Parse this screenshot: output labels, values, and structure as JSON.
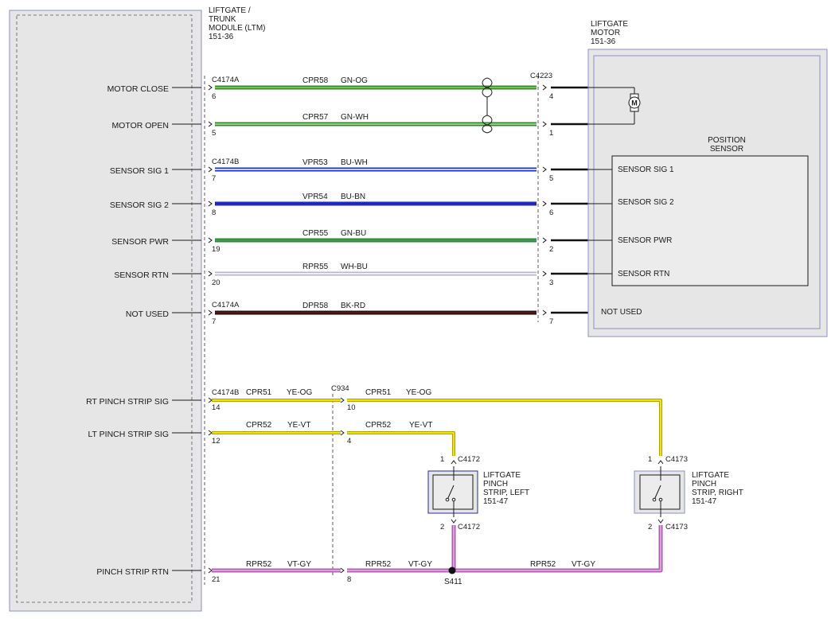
{
  "module": {
    "title_lines": [
      "LIFTGATE /",
      "TRUNK",
      "MODULE (LTM)",
      "151-36"
    ],
    "signals": [
      {
        "id": "motor-close",
        "label": "MOTOR CLOSE"
      },
      {
        "id": "motor-open",
        "label": "MOTOR OPEN"
      },
      {
        "id": "sensor-sig-1",
        "label": "SENSOR SIG 1"
      },
      {
        "id": "sensor-sig-2",
        "label": "SENSOR SIG 2"
      },
      {
        "id": "sensor-pwr",
        "label": "SENSOR PWR"
      },
      {
        "id": "sensor-rtn",
        "label": "SENSOR RTN"
      },
      {
        "id": "not-used",
        "label": "NOT USED"
      },
      {
        "id": "rt-pinch-strip-sig",
        "label": "RT PINCH STRIP SIG"
      },
      {
        "id": "lt-pinch-strip-sig",
        "label": "LT PINCH STRIP SIG"
      },
      {
        "id": "pinch-strip-rtn",
        "label": "PINCH STRIP RTN"
      }
    ]
  },
  "motor_module": {
    "title_lines": [
      "LIFTGATE",
      "MOTOR",
      "151-36"
    ],
    "motor_symbol": "M",
    "sensor_title_lines": [
      "POSITION",
      "SENSOR"
    ],
    "sensor_pins": [
      "SENSOR SIG 1",
      "SENSOR SIG 2",
      "SENSOR PWR",
      "SENSOR RTN"
    ],
    "not_used_label": "NOT USED"
  },
  "motor_wires": [
    {
      "id": "cpr58",
      "circuit": "CPR58",
      "color_code": "GN-OG",
      "left_connector": "C4174A",
      "left_pin": "6",
      "right_connector": "C4223",
      "right_pin": "4",
      "stroke": "#2e8b2e",
      "stripe": "#8fd14f"
    },
    {
      "id": "cpr57",
      "circuit": "CPR57",
      "color_code": "GN-WH",
      "left_connector": "",
      "left_pin": "5",
      "right_connector": "",
      "right_pin": "1",
      "stroke": "#2e8b2e",
      "stripe": "#b6e0a0"
    },
    {
      "id": "vpr53",
      "circuit": "VPR53",
      "color_code": "BU-WH",
      "left_connector": "C4174B",
      "left_pin": "7",
      "right_connector": "",
      "right_pin": "5",
      "stroke": "#1a2fd0",
      "stripe": "#ffffff"
    },
    {
      "id": "vpr54",
      "circuit": "VPR54",
      "color_code": "BU-BN",
      "left_connector": "",
      "left_pin": "8",
      "right_connector": "",
      "right_pin": "6",
      "stroke": "#1a2fd0",
      "stripe": "#2a1fa0"
    },
    {
      "id": "cpr55",
      "circuit": "CPR55",
      "color_code": "GN-BU",
      "left_connector": "",
      "left_pin": "19",
      "right_connector": "",
      "right_pin": "2",
      "stroke": "#2e8b2e",
      "stripe": "#4a9a6a"
    },
    {
      "id": "rpr55",
      "circuit": "RPR55",
      "color_code": "WH-BU",
      "left_connector": "",
      "left_pin": "20",
      "right_connector": "",
      "right_pin": "3",
      "stroke": "#b8b8c8",
      "stripe": "#ffffff"
    },
    {
      "id": "dpr58",
      "circuit": "DPR58",
      "color_code": "BK-RD",
      "left_connector": "C4174A",
      "left_pin": "7",
      "right_connector": "",
      "right_pin": "7",
      "stroke": "#2a1010",
      "stripe": "#5a1a1a"
    }
  ],
  "pinch": {
    "inline_connector": "C934",
    "rt_sig": {
      "left_connector": "C4174B",
      "left_pin": "14",
      "inline_pin": "10",
      "circuit": "CPR51",
      "color_code": "YE-OG"
    },
    "lt_sig": {
      "left_pin": "12",
      "inline_pin": "4",
      "circuit": "CPR52",
      "color_code": "YE-VT"
    },
    "rtn": {
      "left_pin": "21",
      "inline_pin": "8",
      "circuit": "RPR52",
      "color_code": "VT-GY",
      "splice": "S411"
    },
    "yellow": "#f2e400",
    "violet": "#d17bd1",
    "left_strip": {
      "title_lines": [
        "LIFTGATE",
        "PINCH",
        "STRIP, LEFT",
        "151-47"
      ],
      "connector": "C4172",
      "pin_top": "1",
      "pin_bottom": "2"
    },
    "right_strip": {
      "title_lines": [
        "LIFTGATE",
        "PINCH",
        "STRIP, RIGHT",
        "151-47"
      ],
      "connector": "C4173",
      "pin_top": "1",
      "pin_bottom": "2"
    }
  },
  "colors": {
    "module_fill": "#e6e6e6",
    "module_border": "#8a90c0",
    "ink": "#1a1a1a"
  }
}
